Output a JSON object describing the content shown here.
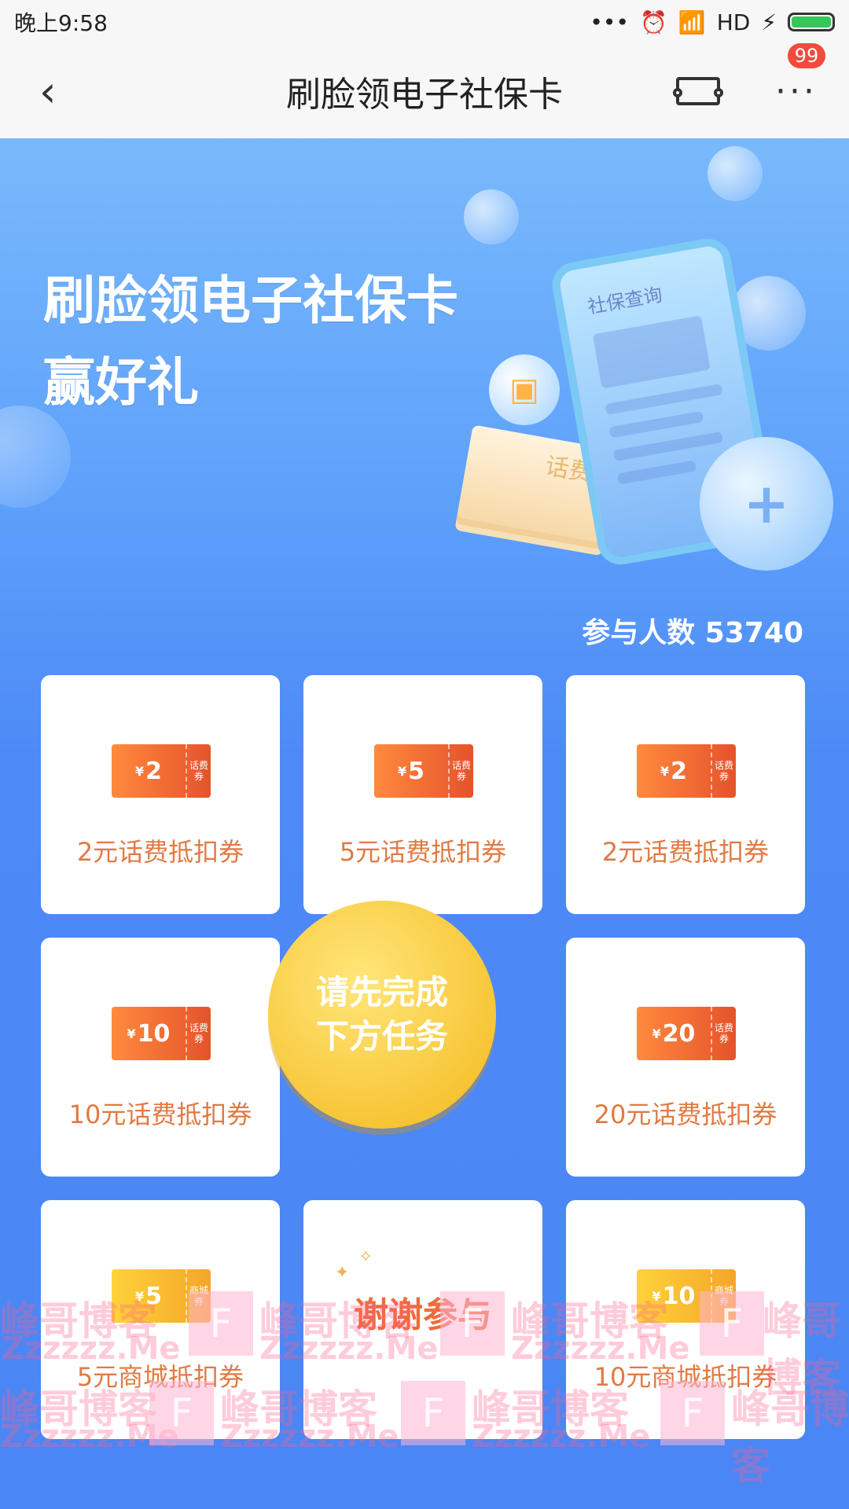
{
  "status_bar": {
    "time": "晚上9:58",
    "dots": "•••",
    "signal": "HD"
  },
  "nav": {
    "back": "‹",
    "title": "刷脸领电子社保卡",
    "more": "···",
    "badge": "99"
  },
  "hero": {
    "title_line1": "刷脸领电子社保卡",
    "title_line2": "赢好礼",
    "phone_text": "社保查询",
    "ticket_text": "话费",
    "shield_symbol": "+",
    "wallet_symbol": "▣"
  },
  "participants": "参与人数 53740",
  "cards": [
    {
      "value": "2",
      "tag": "话费券",
      "label": "2元话费抵扣券",
      "style": "orange"
    },
    {
      "value": "5",
      "tag": "话费券",
      "label": "5元话费抵扣券",
      "style": "orange"
    },
    {
      "value": "2",
      "tag": "话费券",
      "label": "2元话费抵扣券",
      "style": "orange"
    },
    {
      "value": "10",
      "tag": "话费券",
      "label": "10元话费抵扣券",
      "style": "orange"
    },
    {
      "value": "20",
      "tag": "话费券",
      "label": "20元话费抵扣券",
      "style": "orange"
    },
    {
      "value": "5",
      "tag": "商城券",
      "label": "5元商城抵扣券",
      "style": "yellow"
    },
    {
      "value": "10",
      "tag": "商城券",
      "label": "10元商城抵扣券",
      "style": "yellow"
    }
  ],
  "currency_symbol": "¥",
  "center_button": {
    "line1": "请先完成",
    "line2": "下方任务"
  },
  "thanks": "谢谢参与",
  "watermark": {
    "name": "峰哥博客",
    "url": "Zzzzzz.Me",
    "logo": "F"
  }
}
